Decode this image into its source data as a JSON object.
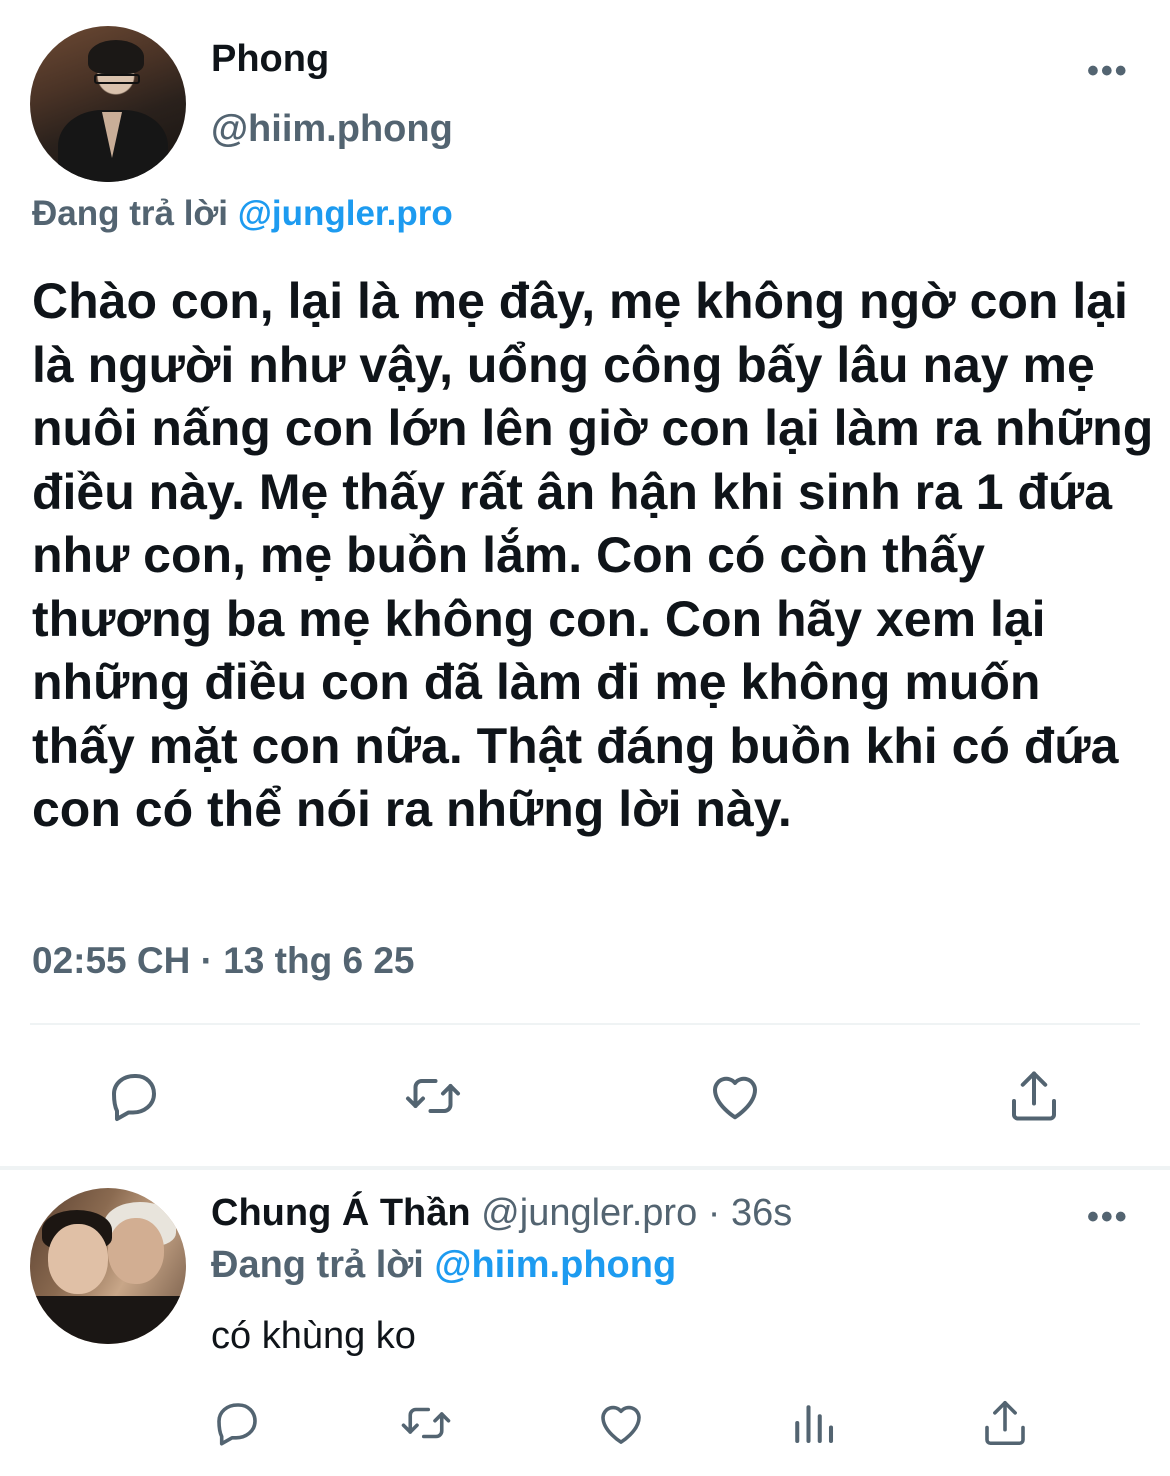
{
  "colors": {
    "text_primary": "#0f1419",
    "text_secondary": "#536471",
    "accent": "#1d9bf0",
    "divider": "#eff3f4"
  },
  "main_tweet": {
    "author_name": "Phong",
    "author_handle": "@hiim.phong",
    "more_label": "•••",
    "replying_prefix": "Đang trả lời ",
    "replying_to": "@jungler.pro",
    "text": "Chào con, lại là mẹ đây, mẹ không ngờ con lại là người như vậy, uổng công bấy lâu nay mẹ nuôi nấng con lớn lên giờ con lại làm ra những điều này. Mẹ thấy rất ân hận khi sinh ra 1 đứa như con, mẹ buồn lắm. Con có còn thấy thương ba mẹ không con. Con hãy xem lại những điều con đã làm đi mẹ không muốn thấy mặt con nữa. Thật đáng buồn khi có đứa con có thể nói ra những lời này.",
    "timestamp": "02:55 CH · 13 thg 6 25",
    "actions": [
      "reply-icon",
      "retweet-icon",
      "heart-icon",
      "share-icon"
    ]
  },
  "reply_tweet": {
    "author_name": "Chung Á Thần",
    "author_handle": " @jungler.pro",
    "time_sep": " · 36s",
    "more_label": "•••",
    "replying_prefix": "Đang trả lời ",
    "replying_to": "@hiim.phong",
    "text": "có khùng ko",
    "actions": [
      "reply-icon",
      "retweet-icon",
      "heart-icon",
      "views-icon",
      "share-icon"
    ]
  }
}
